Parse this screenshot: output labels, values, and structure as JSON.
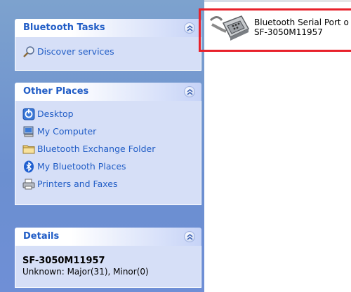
{
  "bluetooth_tasks": {
    "title": "Bluetooth Tasks",
    "items": [
      {
        "label": "Discover services",
        "icon": "magnifier-icon"
      }
    ]
  },
  "other_places": {
    "title": "Other Places",
    "items": [
      {
        "label": "Desktop",
        "icon": "desktop-icon"
      },
      {
        "label": "My Computer",
        "icon": "computer-icon"
      },
      {
        "label": "Bluetooth Exchange Folder",
        "icon": "folder-icon"
      },
      {
        "label": "My Bluetooth Places",
        "icon": "bluetooth-icon"
      },
      {
        "label": "Printers and Faxes",
        "icon": "printer-icon"
      }
    ]
  },
  "details": {
    "title": "Details",
    "device_name": "SF-3050M11957",
    "device_class": "Unknown: Major(31), Minor(0)"
  },
  "content": {
    "item_name": "Bluetooth Serial Port o",
    "item_device": "SF-3050M11957",
    "icon": "serial-port-icon"
  },
  "colors": {
    "link": "#215dc6",
    "highlight": "#e8212b",
    "pane_bg": "#6b8fd0"
  }
}
